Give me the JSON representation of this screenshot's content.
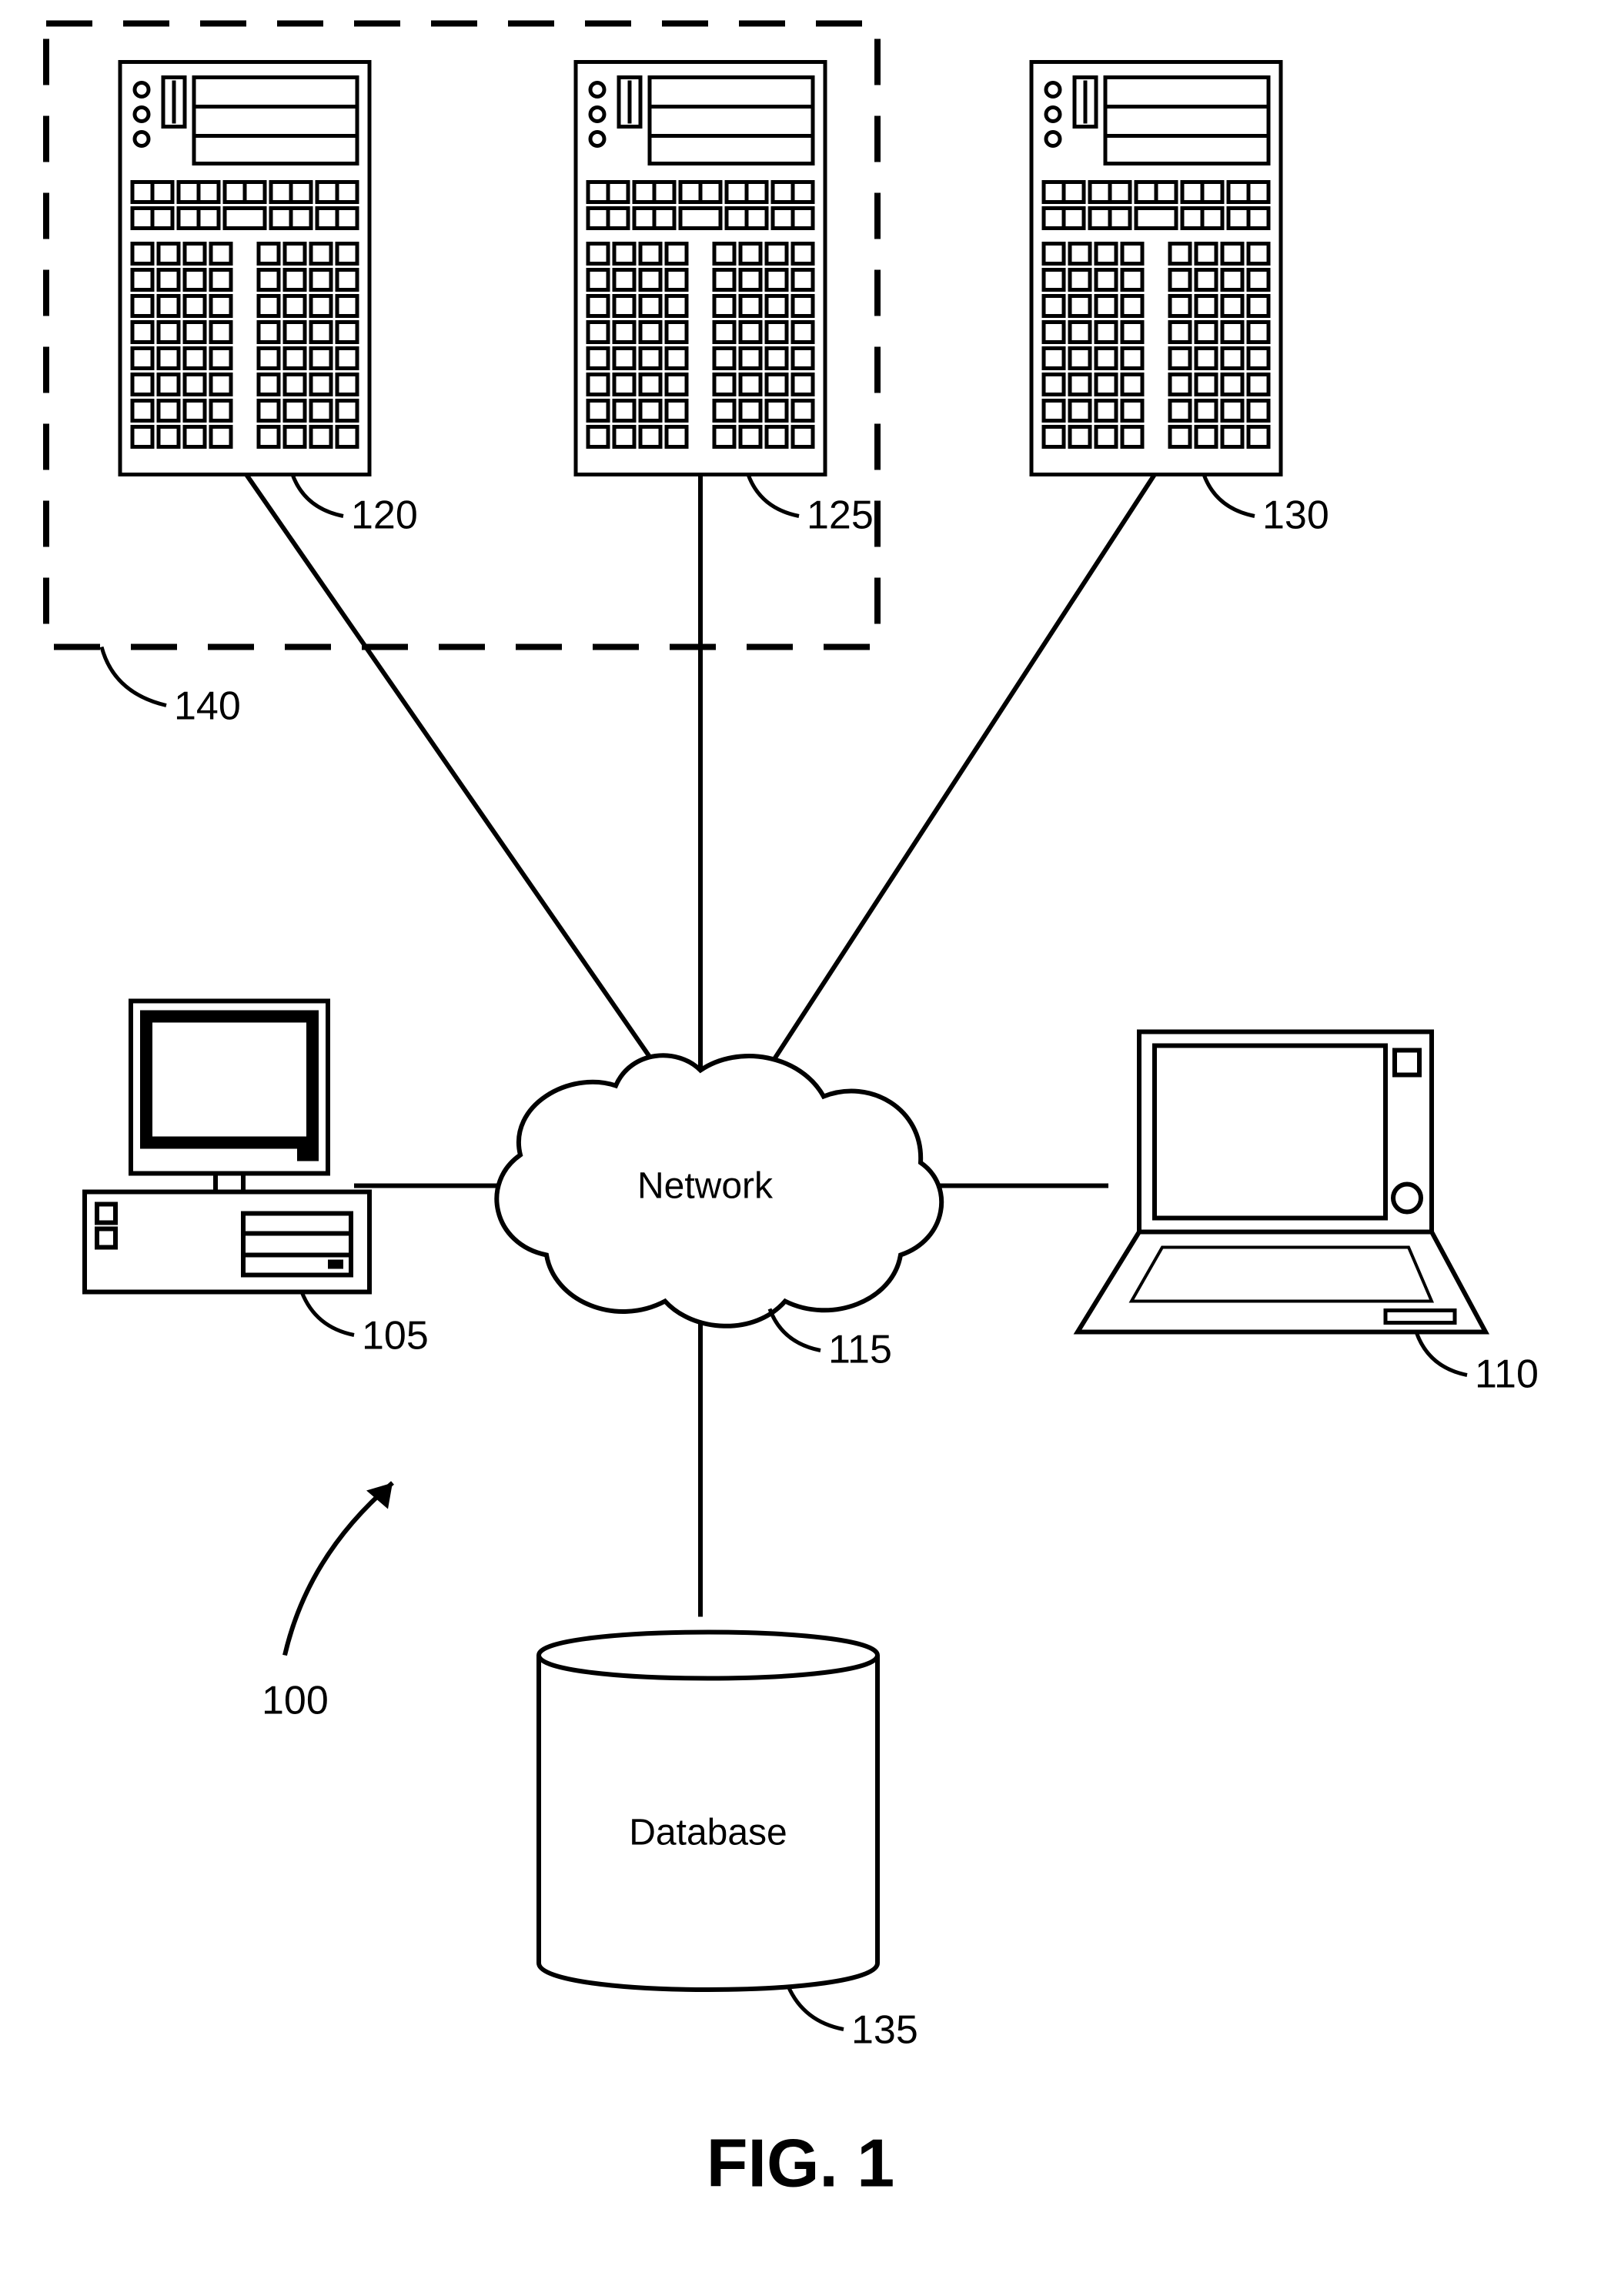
{
  "figure": {
    "caption": "FIG. 1",
    "system_ref": "100",
    "nodes": {
      "network": {
        "label": "Network",
        "ref": "115"
      },
      "database": {
        "label": "Database",
        "ref": "135"
      },
      "server_a": {
        "ref": "120"
      },
      "server_b": {
        "ref": "125"
      },
      "server_c": {
        "ref": "130"
      },
      "server_group": {
        "ref": "140"
      },
      "desktop": {
        "ref": "105"
      },
      "laptop": {
        "ref": "110"
      }
    }
  }
}
